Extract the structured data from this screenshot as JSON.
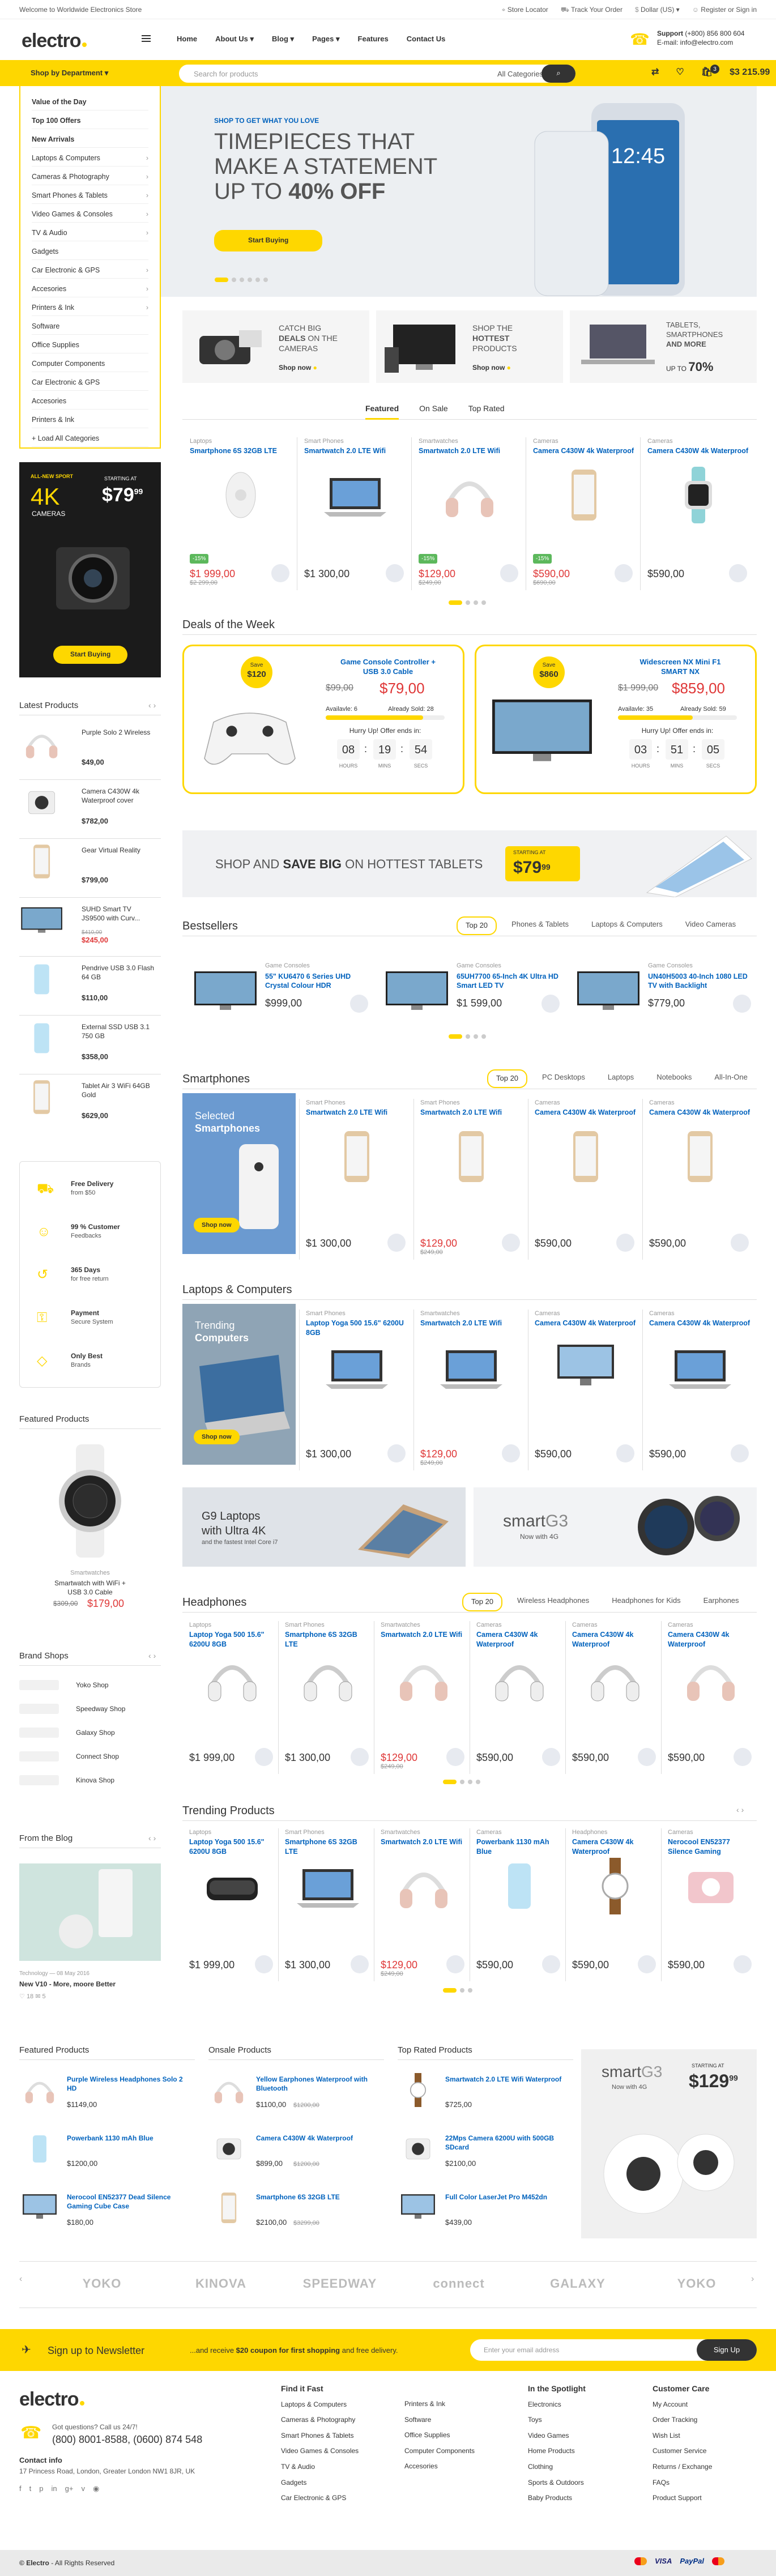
{
  "topbar": {
    "welcome": "Welcome to Worldwide Electronics Store",
    "store": "Store Locator",
    "track": "Track Your Order",
    "currency": "Dollar (US)",
    "account": "Register or Sign in"
  },
  "header": {
    "logo": "electro",
    "nav": [
      "Home",
      "About Us",
      "Blog",
      "Pages",
      "Features",
      "Contact Us"
    ],
    "support_label": "Support",
    "support_phone": "(+800) 856 800 604",
    "support_email": "E-mail: info@electro.com"
  },
  "search": {
    "placeholder": "Search for products",
    "category": "All Categories",
    "dept_button": "Shop by Department",
    "cart_count": "3",
    "wishlist_count": "0",
    "cart_total": "$3 215.99"
  },
  "departments": [
    {
      "label": "Value of the Day",
      "bold": true
    },
    {
      "label": "Top 100 Offers",
      "bold": true
    },
    {
      "label": "New Arrivals",
      "bold": true
    },
    {
      "label": "Laptops & Computers"
    },
    {
      "label": "Cameras & Photography"
    },
    {
      "label": "Smart Phones & Tablets"
    },
    {
      "label": "Video Games & Consoles"
    },
    {
      "label": "TV & Audio"
    },
    {
      "label": "Gadgets"
    },
    {
      "label": "Car Electronic & GPS"
    },
    {
      "label": "Accesories"
    },
    {
      "label": "Printers & Ink"
    },
    {
      "label": "Software"
    },
    {
      "label": "Office Supplies"
    },
    {
      "label": "Computer Components"
    },
    {
      "label": "Car Electronic & GPS"
    },
    {
      "label": "Accesories"
    },
    {
      "label": "Printers & Ink"
    },
    {
      "label": "+ Load All Categories"
    }
  ],
  "hero": {
    "kicker": "SHOP TO GET WHAT YOU LOVE",
    "line1": "TIMEPIECES THAT",
    "line2": "MAKE A STATEMENT",
    "line3a": "UP TO",
    "line3b": "40% OFF",
    "cta": "Start Buying",
    "phone_time": "12:45"
  },
  "promos": [
    {
      "t1": "CATCH BIG",
      "t2": "DEALS",
      "t3": "ON THE CAMERAS",
      "cta": "Shop now"
    },
    {
      "t1": "SHOP THE",
      "t2": "HOTTEST",
      "t3": "PRODUCTS",
      "cta": "Shop now"
    },
    {
      "t1": "TABLETS, SMARTPHONES",
      "t2": "AND MORE",
      "t3": "UP TO",
      "pct": "70%"
    }
  ],
  "featured_tabs": [
    "Featured",
    "On Sale",
    "Top Rated"
  ],
  "featured": [
    {
      "cat": "Laptops",
      "name": "Smartphone 6S 32GB LTE",
      "price": "$1 999,00",
      "old": "$2 299,00",
      "sale": true,
      "badge": "-15%"
    },
    {
      "cat": "Smart Phones",
      "name": "Smartwatch 2.0 LTE Wifi",
      "price": "$1 300,00"
    },
    {
      "cat": "Smartwatches",
      "name": "Smartwatch 2.0 LTE Wifi",
      "price": "$129,00",
      "old": "$249,00",
      "sale": true,
      "badge": "-15%"
    },
    {
      "cat": "Cameras",
      "name": "Camera C430W 4k Waterproof",
      "price": "$590,00",
      "old": "$690,00",
      "sale": true,
      "badge": "-15%"
    },
    {
      "cat": "Cameras",
      "name": "Camera C430W 4k Waterproof",
      "price": "$590,00"
    }
  ],
  "deals": {
    "title": "Deals of the Week",
    "items": [
      {
        "save": "Save",
        "amt": "$120",
        "name": "Game Console Controller + USB 3.0 Cable",
        "old": "$99,00",
        "price": "$79,00",
        "avail": "Availavle: 6",
        "sold": "Already Sold: 28",
        "hurry": "Hurry Up! Offer ends in:",
        "h": "08",
        "m": "19",
        "s": "54"
      },
      {
        "save": "Save",
        "amt": "$860",
        "name": "Widescreen NX Mini F1 SMART NX",
        "old": "$1 999,00",
        "price": "$859,00",
        "avail": "Availavle: 35",
        "sold": "Already Sold: 59",
        "hurry": "Hurry Up! Offer ends in:",
        "h": "03",
        "m": "51",
        "s": "05"
      }
    ],
    "hours": "HOURS",
    "mins": "MINS",
    "secs": "SECS"
  },
  "tablet_banner": {
    "a": "SHOP AND",
    "b": "SAVE BIG",
    "c": "ON HOTTEST TABLETS",
    "starting": "STARTING AT",
    "price": "$79",
    "cents": "99"
  },
  "bestsellers": {
    "title": "Bestsellers",
    "tabs": [
      "Top 20",
      "Phones & Tablets",
      "Laptops & Computers",
      "Video Cameras"
    ],
    "items": [
      {
        "cat": "Game Consoles",
        "name": "55\" KU6470 6 Series UHD Crystal Colour HDR",
        "price": "$999,00"
      },
      {
        "cat": "Game Consoles",
        "name": "65UH7700 65-Inch 4K Ultra HD Smart LED TV",
        "price": "$1 599,00"
      },
      {
        "cat": "Game Consoles",
        "name": "UN40H5003 40-Inch 1080 LED TV with Backlight",
        "price": "$779,00"
      }
    ]
  },
  "smartphones": {
    "title": "Smartphones",
    "tabs": [
      "Top 20",
      "PC Desktops",
      "Laptops",
      "Notebooks",
      "All-In-One"
    ],
    "promo1": "Selected",
    "promo2": "Smartphones",
    "cta": "Shop now",
    "items": [
      {
        "cat": "Smart Phones",
        "name": "Smartwatch 2.0 LTE Wifi",
        "price": "$1 300,00"
      },
      {
        "cat": "Smart Phones",
        "name": "Smartwatch 2.0 LTE Wifi",
        "price": "$129,00",
        "old": "$249,00",
        "sale": true
      },
      {
        "cat": "Cameras",
        "name": "Camera C430W 4k Waterproof",
        "price": "$590,00"
      },
      {
        "cat": "Cameras",
        "name": "Camera C430W 4k Waterproof",
        "price": "$590,00"
      }
    ]
  },
  "laptops": {
    "title": "Laptops & Computers",
    "promo1": "Trending",
    "promo2": "Computers",
    "cta": "Shop now",
    "items": [
      {
        "cat": "Smart Phones",
        "name": "Laptop Yoga 500 15.6\" 6200U 8GB",
        "price": "$1 300,00"
      },
      {
        "cat": "Smartwatches",
        "name": "Smartwatch 2.0 LTE Wifi",
        "price": "$129,00",
        "old": "$249,00",
        "sale": true
      },
      {
        "cat": "Cameras",
        "name": "Camera C430W 4k Waterproof",
        "price": "$590,00"
      },
      {
        "cat": "Cameras",
        "name": "Camera C430W 4k Waterproof",
        "price": "$590,00"
      }
    ]
  },
  "ad_banners": {
    "a1": "G9 Laptops",
    "a2": "with Ultra 4K",
    "a3": "and the fastest Intel Core i7",
    "b1": "smart",
    "b2": "G3",
    "b3": "Now with 4G"
  },
  "headphones": {
    "title": "Headphones",
    "tabs": [
      "Top 20",
      "Wireless Headphones",
      "Headphones for Kids",
      "Earphones"
    ],
    "items": [
      {
        "cat": "Laptops",
        "name": "Laptop Yoga 500 15.6\" 6200U 8GB",
        "price": "$1 999,00"
      },
      {
        "cat": "Smart Phones",
        "name": "Smartphone 6S 32GB LTE",
        "price": "$1 300,00"
      },
      {
        "cat": "Smartwatches",
        "name": "Smartwatch 2.0 LTE Wifi",
        "price": "$129,00",
        "old": "$249,00",
        "sale": true
      },
      {
        "cat": "Cameras",
        "name": "Camera C430W 4k Waterproof",
        "price": "$590,00"
      },
      {
        "cat": "Cameras",
        "name": "Camera C430W 4k Waterproof",
        "price": "$590,00"
      },
      {
        "cat": "Cameras",
        "name": "Camera C430W 4k Waterproof",
        "price": "$590,00"
      }
    ]
  },
  "trending": {
    "title": "Trending Products",
    "items": [
      {
        "cat": "Laptops",
        "name": "Laptop Yoga 500 15.6\" 6200U 8GB",
        "price": "$1 999,00"
      },
      {
        "cat": "Smart Phones",
        "name": "Smartphone 6S 32GB LTE",
        "price": "$1 300,00"
      },
      {
        "cat": "Smartwatches",
        "name": "Smartwatch 2.0 LTE Wifi",
        "price": "$129,00",
        "old": "$249,00",
        "sale": true
      },
      {
        "cat": "Cameras",
        "name": "Powerbank 1130 mAh Blue",
        "price": "$590,00"
      },
      {
        "cat": "Headphones",
        "name": "Camera C430W 4k Waterproof",
        "price": "$590,00"
      },
      {
        "cat": "Cameras",
        "name": "Nerocool EN52377 Silence Gaming",
        "price": "$590,00"
      }
    ]
  },
  "sidebar": {
    "ad_new": "ALL-NEW SPORT",
    "ad_4k": "4K",
    "ad_cam": "CAMERAS",
    "ad_starting": "STARTING AT",
    "ad_price": "$79",
    "ad_cents": "99",
    "ad_cta": "Start Buying",
    "latest_title": "Latest Products",
    "latest": [
      {
        "name": "Purple Solo 2 Wireless",
        "price": "$49,00"
      },
      {
        "name": "Camera C430W 4k Waterproof cover",
        "price": "$782,00"
      },
      {
        "name": "Gear Virtual Reality",
        "price": "$799,00"
      },
      {
        "name": "SUHD Smart TV JS9500 with Curv...",
        "price": "$245,00",
        "old": "$410,00"
      },
      {
        "name": "Pendrive USB 3.0 Flash 64 GB",
        "price": "$110,00"
      },
      {
        "name": "External SSD USB 3.1 750 GB",
        "price": "$358,00"
      },
      {
        "name": "Tablet Air 3 WiFi 64GB Gold",
        "price": "$629,00"
      }
    ],
    "features": [
      {
        "a": "Free Delivery",
        "b": "from $50"
      },
      {
        "a": "99 % Customer",
        "b": "Feedbacks"
      },
      {
        "a": "365 Days",
        "b": "for free return"
      },
      {
        "a": "Payment",
        "b": "Secure System"
      },
      {
        "a": "Only Best",
        "b": "Brands"
      }
    ],
    "featured_title": "Featured Products",
    "fp_cat": "Smartwatches",
    "fp_name": "Smartwatch with WiFi + USB 3.0 Cable",
    "fp_old": "$309,00",
    "fp_price": "$179,00",
    "brands_title": "Brand Shops",
    "brands": [
      "Yoko Shop",
      "Speedway Shop",
      "Galaxy Shop",
      "Connect Shop",
      "Kinova Shop"
    ],
    "blog_title": "From the Blog",
    "blog_meta": "Technology  —  08 May 2016",
    "blog_post": "New V10 - More, moore Better",
    "blog_likes": "18",
    "blog_comments": "5"
  },
  "bottom_lists": {
    "cols": [
      {
        "title": "Featured Products",
        "items": [
          {
            "name": "Purple Wireless Headphones Solo 2 HD",
            "price": "$1149,00"
          },
          {
            "name": "Powerbank 1130 mAh Blue",
            "price": "$1200,00"
          },
          {
            "name": "Nerocool EN52377 Dead Silence Gaming Cube Case",
            "price": "$180,00"
          }
        ]
      },
      {
        "title": "Onsale Products",
        "items": [
          {
            "name": "Yellow Earphones Waterproof with Bluetooth",
            "price": "$1100,00",
            "old": "$1200,00"
          },
          {
            "name": "Camera C430W 4k Waterproof",
            "price": "$899,00",
            "old": "$1200,00"
          },
          {
            "name": "Smartphone 6S 32GB LTE",
            "price": "$2100,00",
            "old": "$3299,00"
          }
        ]
      },
      {
        "title": "Top Rated Products",
        "items": [
          {
            "name": "Smartwatch 2.0 LTE Wifi Waterproof",
            "price": "$725,00"
          },
          {
            "name": "22Mps Camera 6200U with 500GB SDcard",
            "price": "$2100,00"
          },
          {
            "name": "Full Color LaserJet Pro M452dn",
            "price": "$439,00"
          }
        ]
      }
    ],
    "ad_brand": "smart",
    "ad_brand2": "G3",
    "ad_sub": "Now with 4G",
    "ad_starting": "STARTING AT",
    "ad_price": "$129",
    "ad_cents": "99"
  },
  "brand_logos": [
    "YOKO",
    "KINOVA",
    "SPEEDWAY",
    "connect",
    "GALAXY",
    "YOKO"
  ],
  "newsletter": {
    "title": "Sign up to Newsletter",
    "promo_a": "...and receive",
    "promo_b": "$20 coupon for first shopping",
    "promo_c": "and free delivery.",
    "placeholder": "Enter your email address",
    "button": "Sign Up"
  },
  "footer": {
    "logo": "electro",
    "q": "Got questions? Call us 24/7!",
    "phones": "(800) 8001-8588, (0600) 874 548",
    "contact_title": "Contact info",
    "address": "17 Princess Road, London, Greater London NW1 8JR, UK",
    "col1_title": "Find it Fast",
    "col1": [
      "Laptops & Computers",
      "Cameras & Photography",
      "Smart Phones & Tablets",
      "Video Games & Consoles",
      "TV & Audio",
      "Gadgets",
      "Car Electronic & GPS"
    ],
    "col2": [
      "Printers & Ink",
      "Software",
      "Office Supplies",
      "Computer Components",
      "Accesories"
    ],
    "col3_title": "In the Spotlight",
    "col3": [
      "Electronics",
      "Toys",
      "Video Games",
      "Home Products",
      "Clothing",
      "Sports & Outdoors",
      "Baby Products"
    ],
    "col4_title": "Customer Care",
    "col4": [
      "My Account",
      "Order Tracking",
      "Wish List",
      "Customer Service",
      "Returns / Exchange",
      "FAQs",
      "Product Support"
    ],
    "copy_brand": "Electro",
    "copy": " - All Rights Reserved",
    "payments": [
      "VISA",
      "PayPal"
    ]
  },
  "colors": {
    "accent": "#fed700",
    "link": "#0062bd",
    "sale": "#df3737"
  }
}
